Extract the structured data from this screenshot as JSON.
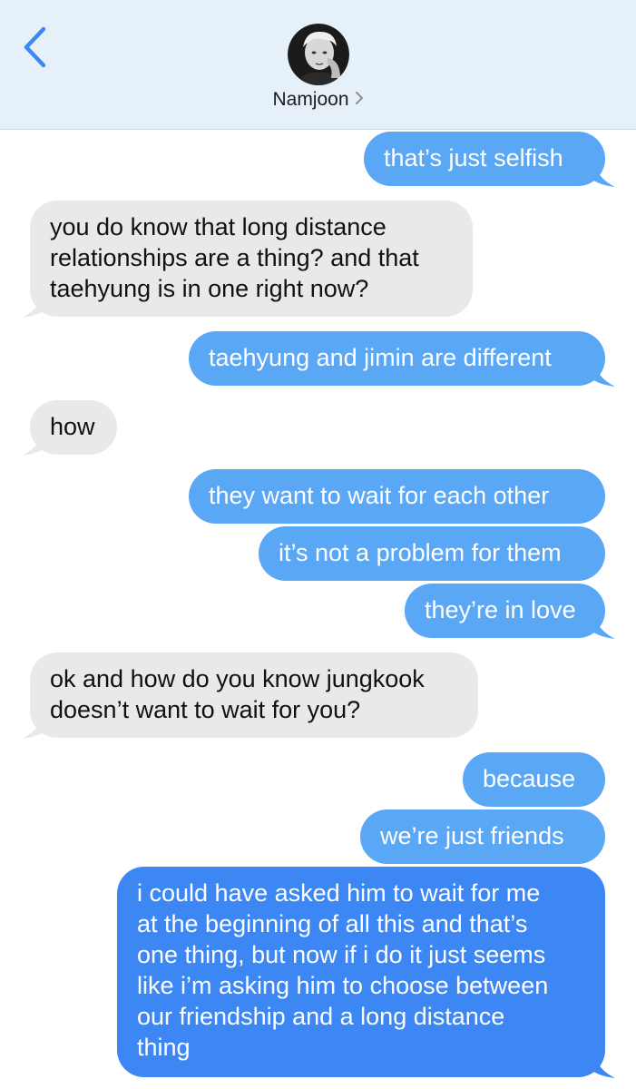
{
  "header": {
    "contact_name": "Namjoon",
    "icons": {
      "back": "chevron-left-icon",
      "contact_chevron": "chevron-right-icon"
    }
  },
  "colors": {
    "header_bg": "#e6f0f9",
    "sent_bubble": "#5aa7f5",
    "sent_bubble_latest": "#3d87f4",
    "received_bubble": "#e9e9eb",
    "back_arrow": "#3a88f5"
  },
  "messages": [
    {
      "direction": "sent",
      "text": "that’s just selfish"
    },
    {
      "direction": "received",
      "text": "you do know that long distance\nrelationships are a thing? and that\ntaehyung is in one right now?"
    },
    {
      "direction": "sent",
      "text": "taehyung and jimin are different"
    },
    {
      "direction": "received",
      "text": "how"
    },
    {
      "direction": "sent",
      "text": "they want to wait for each other"
    },
    {
      "direction": "sent",
      "text": "it’s not a problem for them"
    },
    {
      "direction": "sent",
      "text": "they’re in love"
    },
    {
      "direction": "received",
      "text": "ok and how do you know jungkook\ndoesn’t want to wait for you?"
    },
    {
      "direction": "sent",
      "text": "because"
    },
    {
      "direction": "sent",
      "text": "we’re just friends"
    },
    {
      "direction": "sent",
      "text": "i could have asked him to wait for me\nat the beginning of all this and that’s\none thing, but now if i do it just seems\nlike i’m asking him to choose between\nour friendship and a long distance\nthing"
    }
  ]
}
